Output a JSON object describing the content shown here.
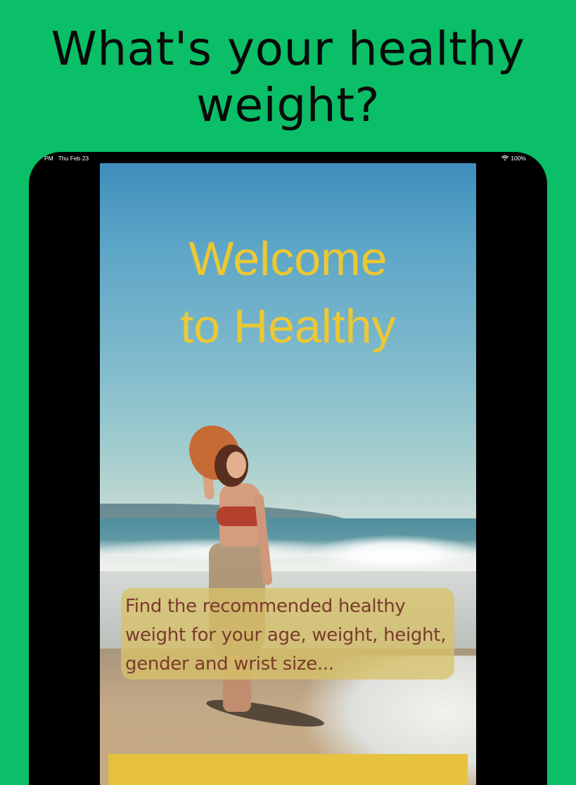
{
  "headline": {
    "line1": "What's your healthy",
    "line2": "weight?"
  },
  "statusbar": {
    "time": "PM",
    "date": "Thu Feb 23",
    "battery": "100%"
  },
  "screen": {
    "welcome_line1": "Welcome",
    "welcome_line2": "to Healthy",
    "description": "Find the recommended healthy weight for your age, weight, height, gender and wrist size..."
  },
  "colors": {
    "background": "#0abf67",
    "accent_yellow": "#ecc833",
    "description_text": "#7b3a2e"
  }
}
